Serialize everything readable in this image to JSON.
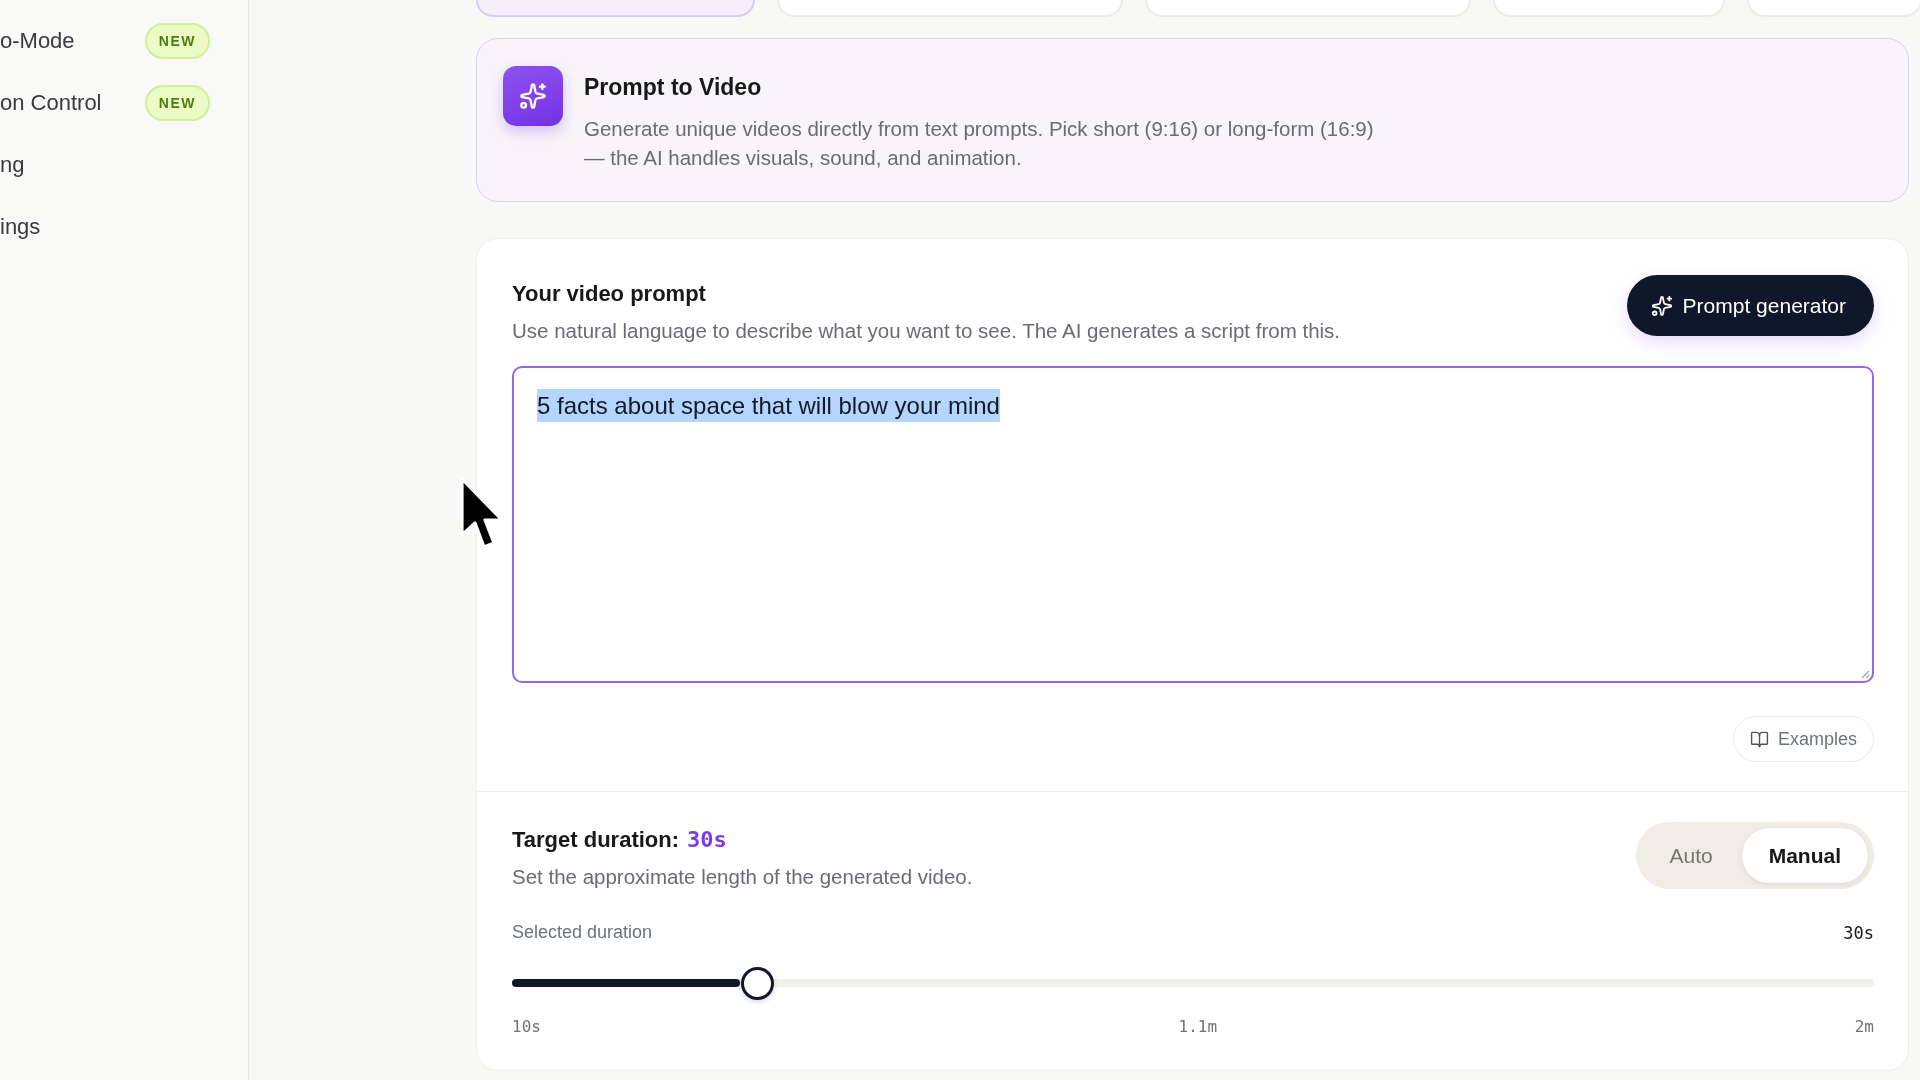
{
  "sidebar": {
    "items": [
      {
        "label": "o-Mode",
        "badge": "NEW"
      },
      {
        "label": "on Control",
        "badge": "NEW"
      },
      {
        "label": "ng"
      },
      {
        "label": "ings"
      }
    ]
  },
  "mode_tabs": [
    {
      "selected": true
    },
    {
      "selected": false
    },
    {
      "selected": false
    },
    {
      "selected": false
    },
    {
      "selected": false
    }
  ],
  "info_card": {
    "title": "Prompt to Video",
    "description": "Generate unique videos directly from text prompts. Pick short (9:16) or long-form (16:9) — the AI handles visuals, sound, and animation."
  },
  "prompt": {
    "title": "Your video prompt",
    "description": "Use natural language to describe what you want to see. The AI generates a script from this.",
    "generator_button": "Prompt generator",
    "value": "5 facts about space that will blow your mind",
    "value_selected": true,
    "focused": true,
    "examples_button": "Examples"
  },
  "duration": {
    "title": "Target duration:",
    "value": "30s",
    "description": "Set the approximate length of the generated video.",
    "modes": [
      {
        "label": "Auto",
        "selected": false
      },
      {
        "label": "Manual",
        "selected": true
      }
    ],
    "slider": {
      "label": "Selected duration",
      "reading": "30s",
      "level": 0.18,
      "ticks": [
        "10s",
        "1.1m",
        "2m"
      ]
    }
  }
}
